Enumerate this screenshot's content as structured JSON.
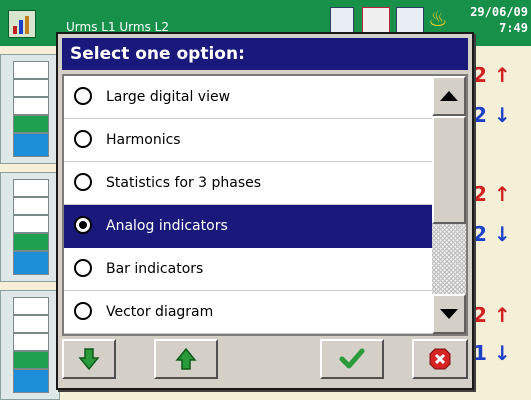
{
  "background": {
    "status_title": "Urms L1 Urms L2",
    "date": "29/06/09",
    "time": "7:49",
    "indicators": [
      {
        "value": "2",
        "direction": "up"
      },
      {
        "value": "2",
        "direction": "down"
      },
      {
        "value": "2",
        "direction": "up"
      },
      {
        "value": "2",
        "direction": "down"
      },
      {
        "value": "2",
        "direction": "up"
      },
      {
        "value": "1",
        "direction": "down"
      }
    ],
    "colors": {
      "topbar": "#17904a",
      "bar_green": "#1fa050",
      "bar_blue": "#1c8fd8"
    }
  },
  "dialog": {
    "title": "Select one option:",
    "selected_index": 3,
    "options": [
      {
        "label": "Large digital view",
        "selected": false
      },
      {
        "label": "Harmonics",
        "selected": false
      },
      {
        "label": "Statistics for 3 phases",
        "selected": false
      },
      {
        "label": "Analog indicators",
        "selected": true
      },
      {
        "label": "Bar indicators",
        "selected": false
      },
      {
        "label": "Vector diagram",
        "selected": false
      }
    ],
    "buttons": [
      {
        "name": "move-down-button",
        "icon": "green-down-arrow-icon"
      },
      {
        "name": "move-up-button",
        "icon": "green-up-arrow-icon"
      },
      {
        "name": "ok-button",
        "icon": "green-checkmark-icon"
      },
      {
        "name": "cancel-button",
        "icon": "red-x-icon"
      }
    ],
    "colors": {
      "title_bar": "#19197c",
      "selection": "#19197c",
      "dialog_face": "#d4d0c8"
    }
  }
}
